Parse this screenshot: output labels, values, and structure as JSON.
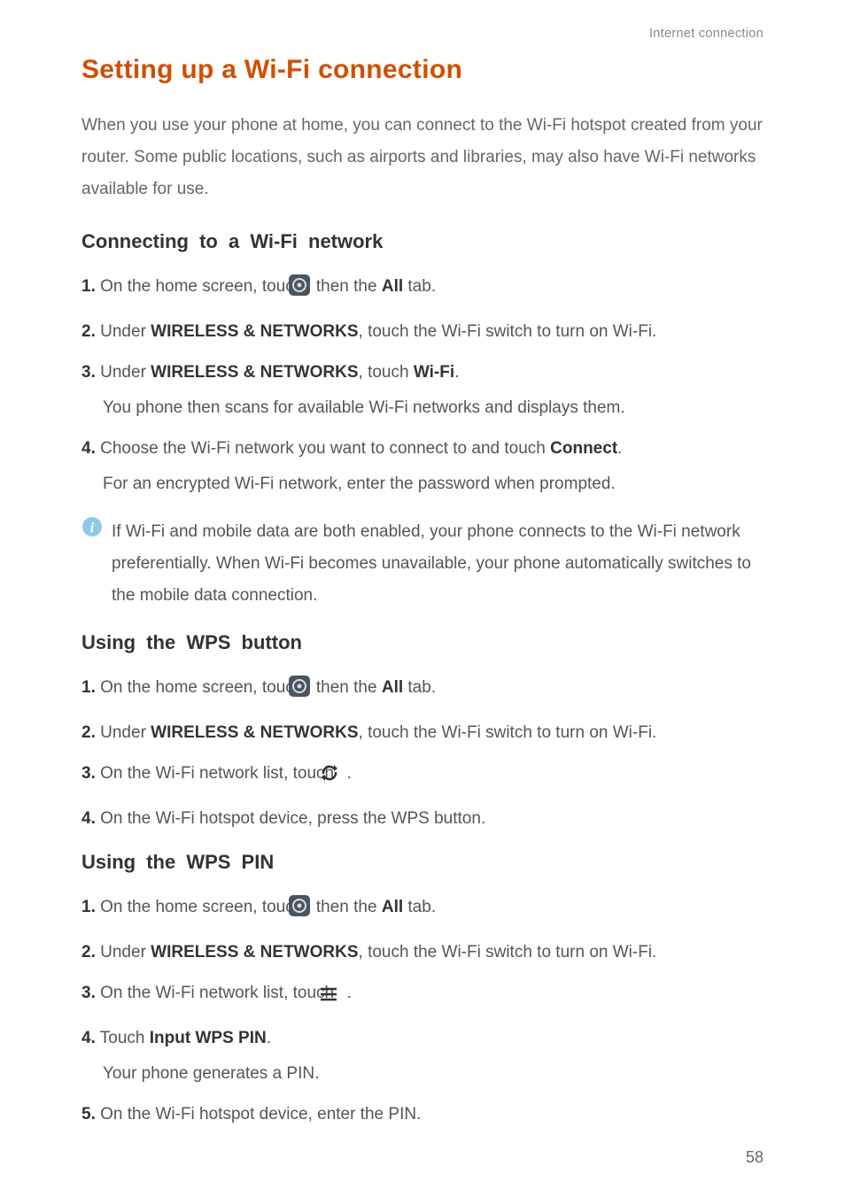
{
  "header": {
    "label": "Internet connection"
  },
  "title": "Setting up a Wi-Fi connection",
  "intro": "When you use your phone at home, you can connect to the Wi-Fi hotspot created from your router. Some public locations, such as airports and libraries, may also have Wi-Fi networks available for use.",
  "sections": {
    "connecting": {
      "heading": "Connecting to a Wi-Fi network",
      "steps": {
        "s1": {
          "num": "1.",
          "pre": "On the home screen, touch ",
          "post": " then the ",
          "bold": "All",
          "tail": " tab."
        },
        "s2": {
          "num": "2.",
          "pre": "Under ",
          "bold": "WIRELESS & NETWORKS",
          "post": ", touch the Wi-Fi switch to turn on Wi-Fi."
        },
        "s3": {
          "num": "3.",
          "pre": "Under ",
          "bold1": "WIRELESS & NETWORKS",
          "mid": ", touch ",
          "bold2": "Wi-Fi",
          "post": ".",
          "sub": "You phone then scans for available Wi-Fi networks and displays them."
        },
        "s4": {
          "num": "4.",
          "pre": "Choose the Wi-Fi network you want to connect to and touch ",
          "bold": "Connect",
          "post": ".",
          "sub": "For an encrypted Wi-Fi network, enter the password when prompted."
        }
      },
      "note": "If Wi-Fi and mobile data are both enabled, your phone connects to the Wi-Fi network preferentially. When Wi-Fi becomes unavailable, your phone automatically switches to the mobile data connection."
    },
    "wps_button": {
      "heading": "Using the WPS button",
      "steps": {
        "s1": {
          "num": "1.",
          "pre": "On the home screen, touch ",
          "post": " then the ",
          "bold": "All",
          "tail": " tab."
        },
        "s2": {
          "num": "2.",
          "pre": "Under ",
          "bold": "WIRELESS & NETWORKS",
          "post": ", touch the Wi-Fi switch to turn on Wi-Fi."
        },
        "s3": {
          "num": "3.",
          "pre": "On the Wi-Fi network list, touch ",
          "post": " ."
        },
        "s4": {
          "num": "4.",
          "text": "On the Wi-Fi hotspot device, press the WPS button."
        }
      }
    },
    "wps_pin": {
      "heading": "Using the WPS PIN",
      "steps": {
        "s1": {
          "num": "1.",
          "pre": "On the home screen, touch ",
          "post": " then the ",
          "bold": "All",
          "tail": " tab."
        },
        "s2": {
          "num": "2.",
          "pre": "Under ",
          "bold": "WIRELESS & NETWORKS",
          "post": ", touch the Wi-Fi switch to turn on Wi-Fi."
        },
        "s3": {
          "num": "3.",
          "pre": "On the Wi-Fi network list, touch ",
          "post": " ."
        },
        "s4": {
          "num": "4.",
          "pre": "Touch ",
          "bold": "Input WPS PIN",
          "post": ".",
          "sub": "Your phone generates a PIN."
        },
        "s5": {
          "num": "5.",
          "text": "On the Wi-Fi hotspot device, enter the PIN."
        }
      }
    }
  },
  "page_number": "58"
}
